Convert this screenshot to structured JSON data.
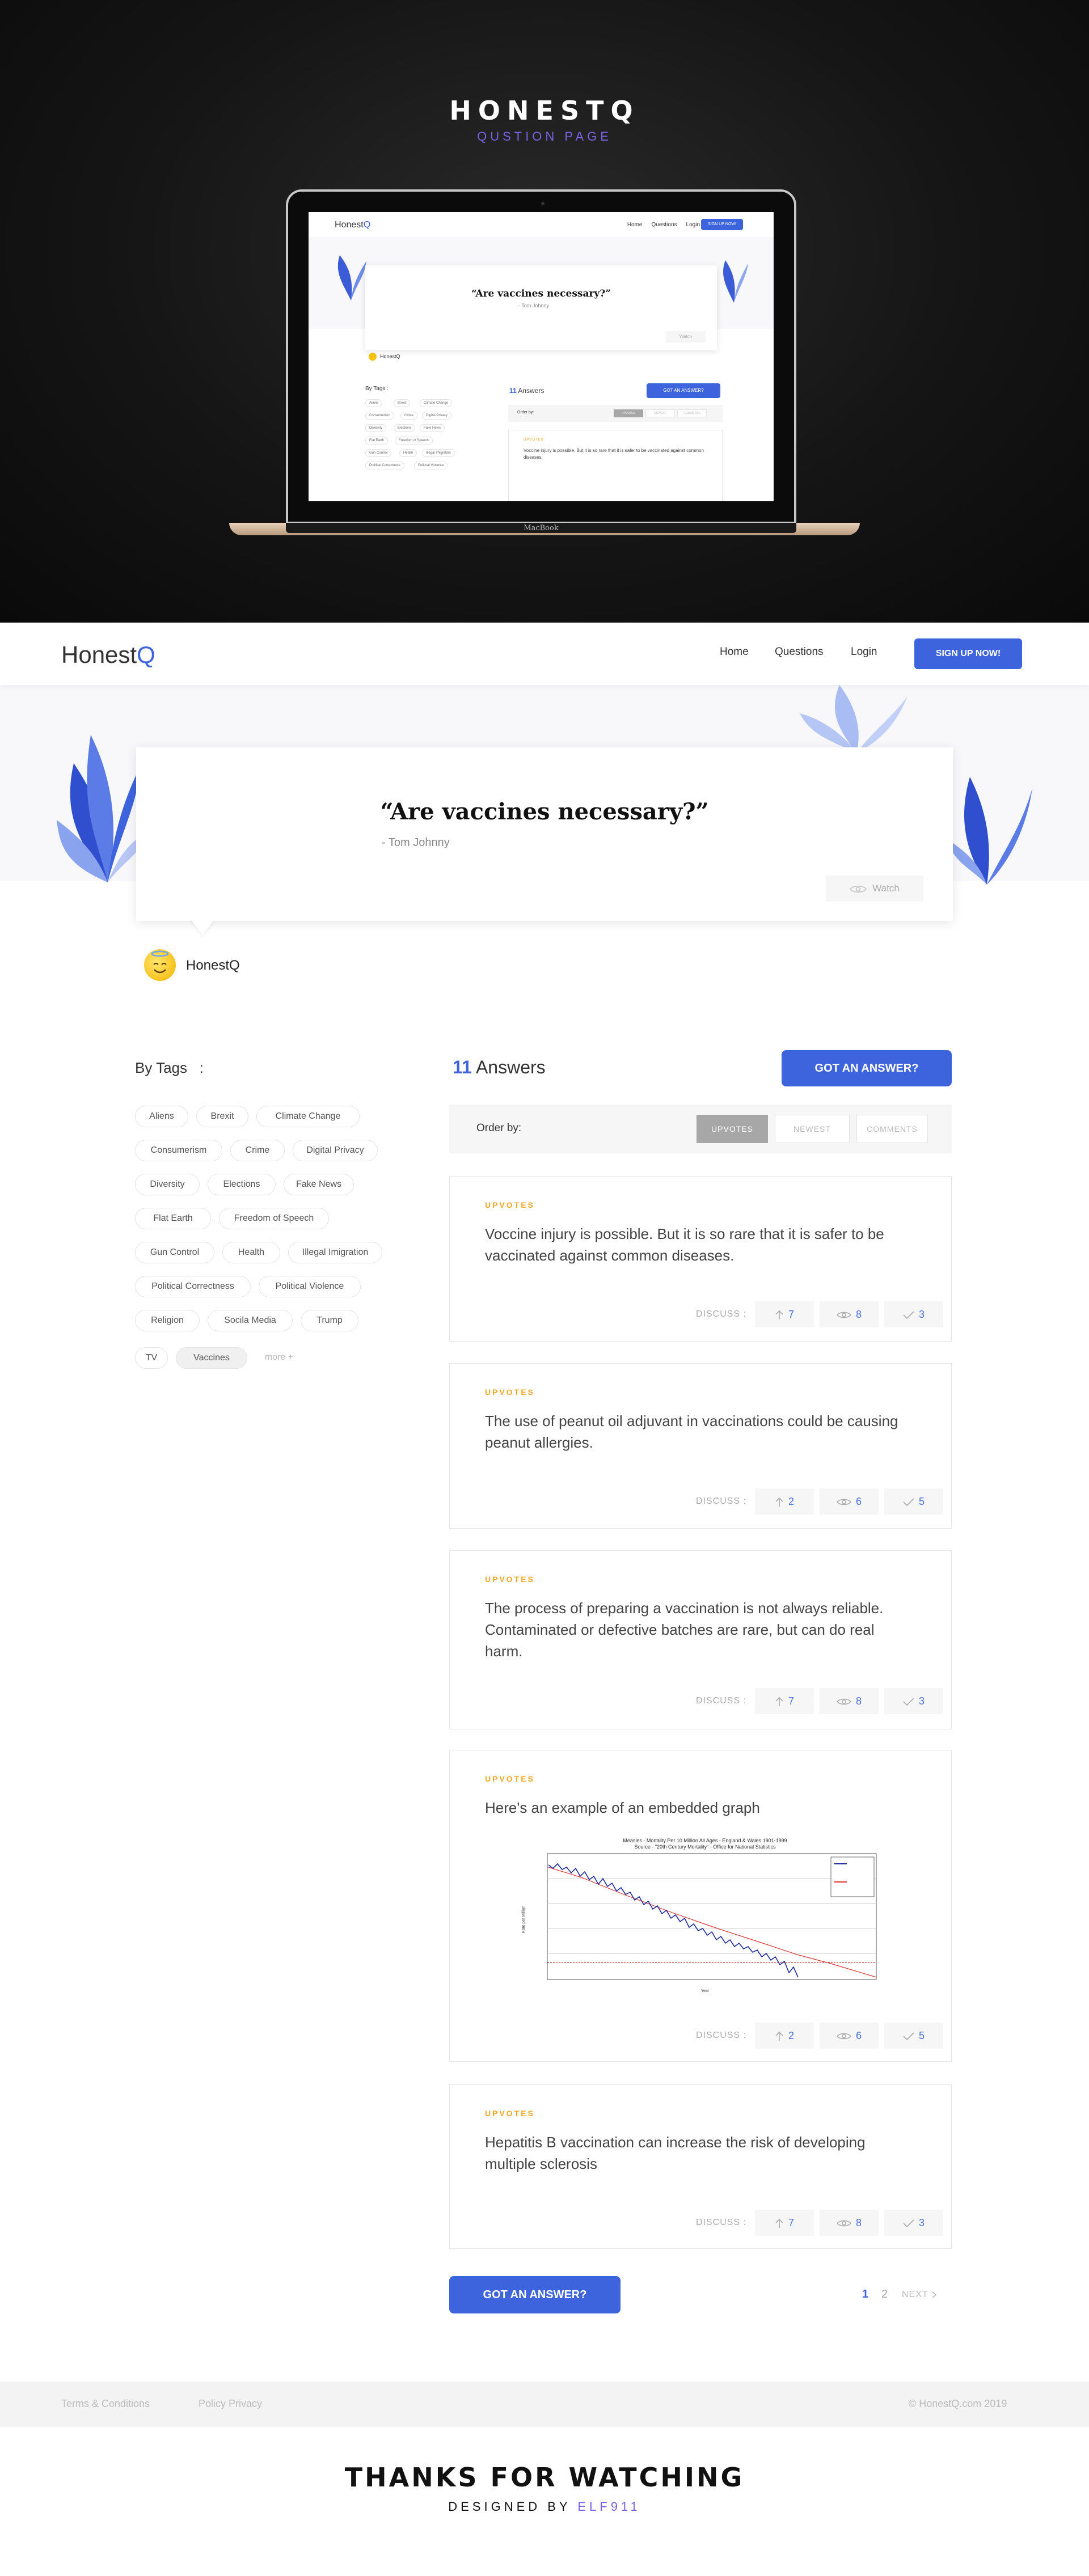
{
  "hero": {
    "title": "HONESTQ",
    "subtitle": "QUSTION PAGE",
    "device_label": "MacBook"
  },
  "nav": {
    "logo_main": "Honest",
    "logo_accent": "Q",
    "links": [
      "Home",
      "Questions",
      "Login"
    ],
    "signup": "SIGN UP NOW!"
  },
  "question": {
    "text": "“Are vaccines necessary?”",
    "author": "- Tom Johnny",
    "watch": "Watch",
    "poster": "HonestQ"
  },
  "tags": {
    "title": "By Tags   :",
    "items": [
      "Aliens",
      "Brexit",
      "Climate Change",
      "Consumerism",
      "Crime",
      "Digital Privacy",
      "Diversity",
      "Elections",
      "Fake News",
      "Flat Earth",
      "Freedom of Speech",
      "Gun Control",
      "Health",
      "Illegal Imigration",
      "Political Correctness",
      "Political Violence",
      "Religion",
      "Socila Media",
      "Trump",
      "TV",
      "Vaccines"
    ],
    "selected": "Vaccines",
    "more": "more +"
  },
  "answers": {
    "count": "11",
    "label": "Answers",
    "got_answer": "GOT AN ANSWER?",
    "order_label": "Order by:",
    "order_options": [
      "UPVOTES",
      "NEWEST",
      "COMMENTS"
    ],
    "discuss_label": "DISCUSS :",
    "upvotes_label": "UPVOTES",
    "items": [
      {
        "text": "Voccine injury is possible. But it is so rare that it is safer to be vaccinated against common diseases.",
        "up": "7",
        "views": "8",
        "checks": "3"
      },
      {
        "text": "The use of peanut oil adjuvant in vaccinations could be causing peanut allergies.",
        "up": "2",
        "views": "6",
        "checks": "5"
      },
      {
        "text": "The process of preparing a vaccination is not always reliable. Contaminated or defective batches are rare, but can do real harm.",
        "up": "7",
        "views": "8",
        "checks": "3"
      },
      {
        "text": "Here's an example of an embedded graph",
        "up": "2",
        "views": "6",
        "checks": "5"
      },
      {
        "text": "Hepatitis B vaccination can increase the risk of developing multiple sclerosis",
        "up": "7",
        "views": "8",
        "checks": "3"
      }
    ],
    "graph": {
      "title": "Measles - Mortality Per 10 Million All Ages - England & Wales 1901-1999",
      "source": "Source - \"20th Century Mortality\" - Office for National Statistics"
    }
  },
  "pagination": {
    "pages": [
      "1",
      "2"
    ],
    "current": "1",
    "next": "NEXT"
  },
  "footer": {
    "terms": "Terms & Conditions",
    "privacy": "Policy Privacy",
    "copyright": "© HonestQ.com 2019"
  },
  "closing": {
    "thanks": "THANKS FOR WATCHING",
    "designed_by": "DESIGNED BY",
    "designer": "ELF911"
  },
  "colors": {
    "accent": "#3d63dd",
    "upvote": "#f5a623",
    "brand_purple": "#7b63e6"
  }
}
